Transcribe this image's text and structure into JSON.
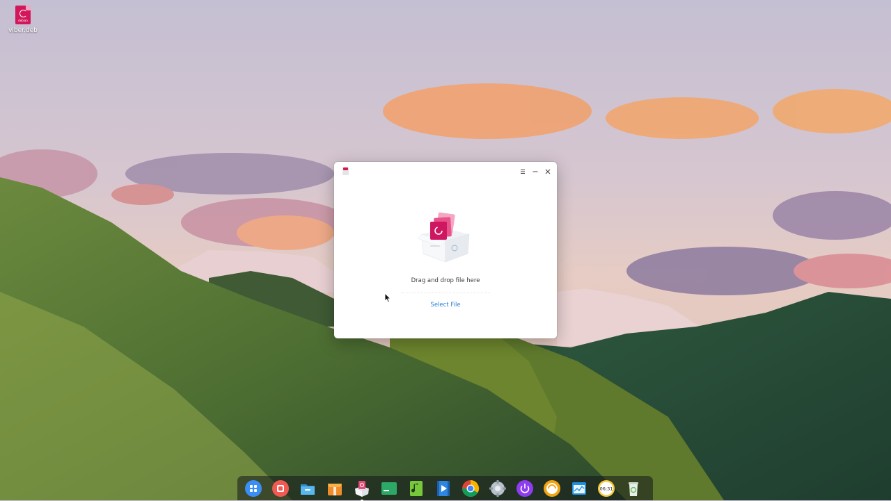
{
  "desktop": {
    "icons": [
      {
        "label": "viber.deb",
        "icon": "debian-package-icon",
        "badge": "debian"
      }
    ]
  },
  "window": {
    "title_icon": "package-installer-icon",
    "controls": {
      "menu": "menu-icon",
      "minimize": "minimize-icon",
      "close": "close-icon"
    },
    "drop_text": "Drag and drop file here",
    "select_file_label": "Select File"
  },
  "dock": {
    "items": [
      {
        "name": "launcher",
        "icon": "launcher-icon",
        "color": "#3b8ef5"
      },
      {
        "name": "multitasking-view",
        "icon": "multitask-icon",
        "color": "#f05a52"
      },
      {
        "name": "file-manager",
        "icon": "folder-icon",
        "color": "#39a8e6"
      },
      {
        "name": "app-store",
        "icon": "store-icon",
        "color": "#f08c2a"
      },
      {
        "name": "package-installer",
        "icon": "package-icon",
        "color": "#e84a7a",
        "active": true
      },
      {
        "name": "terminal",
        "icon": "terminal-icon",
        "color": "#2fbf71"
      },
      {
        "name": "music",
        "icon": "music-icon",
        "color": "#77c93b"
      },
      {
        "name": "video-player",
        "icon": "video-icon",
        "color": "#2f86e0"
      },
      {
        "name": "chrome",
        "icon": "chrome-icon",
        "color": "#db4437"
      },
      {
        "name": "settings",
        "icon": "gear-icon",
        "color": "#b9c2cc"
      },
      {
        "name": "shutdown",
        "icon": "power-icon",
        "color": "#8e3cf0"
      },
      {
        "name": "deepin-browser",
        "icon": "browser-icon",
        "color": "#f2a413"
      },
      {
        "name": "system-monitor",
        "icon": "monitor-icon",
        "color": "#1f8fe0"
      },
      {
        "name": "clock",
        "icon": "clock-icon",
        "color": "#f7c93a",
        "text": "06:31"
      },
      {
        "name": "trash",
        "icon": "trash-icon",
        "color": "#8ed08a"
      }
    ]
  }
}
